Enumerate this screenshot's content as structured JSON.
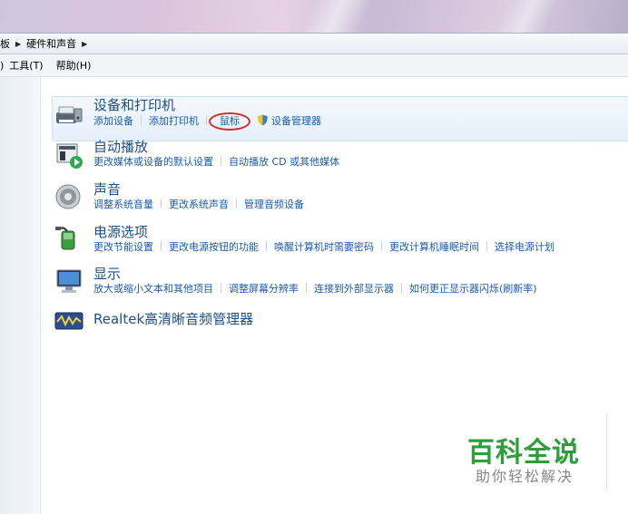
{
  "breadcrumb": {
    "prev_fragment": "板",
    "current": "硬件和声音"
  },
  "menubar": {
    "fragment": ")",
    "tools": "工具(T)",
    "help": "帮助(H)"
  },
  "categories": [
    {
      "title": "设备和打印机",
      "icon": "devices-printer-icon",
      "links": [
        "添加设备",
        "添加打印机",
        "鼠标",
        "设备管理器"
      ]
    },
    {
      "title": "自动播放",
      "icon": "autoplay-icon",
      "links": [
        "更改媒体或设备的默认设置",
        "自动播放 CD 或其他媒体"
      ]
    },
    {
      "title": "声音",
      "icon": "speaker-icon",
      "links": [
        "调整系统音量",
        "更改系统声音",
        "管理音频设备"
      ]
    },
    {
      "title": "电源选项",
      "icon": "power-plug-icon",
      "links": [
        "更改节能设置",
        "更改电源按钮的功能",
        "唤醒计算机时需要密码",
        "更改计算机睡眠时间",
        "选择电源计划"
      ]
    },
    {
      "title": "显示",
      "icon": "monitor-icon",
      "links": [
        "放大或缩小文本和其他项目",
        "调整屏幕分辨率",
        "连接到外部显示器",
        "如何更正显示器闪烁(刷新率)"
      ]
    },
    {
      "title": "Realtek高清晰音频管理器",
      "icon": "realtek-audio-icon",
      "links": []
    }
  ],
  "watermark": {
    "main": "百科全说",
    "sub": "助你轻松解决"
  },
  "colors": {
    "link": "#1a5bb0",
    "title": "#1d4f8a",
    "highlight_circle": "#d23030",
    "watermark": "#2e9e3a"
  }
}
